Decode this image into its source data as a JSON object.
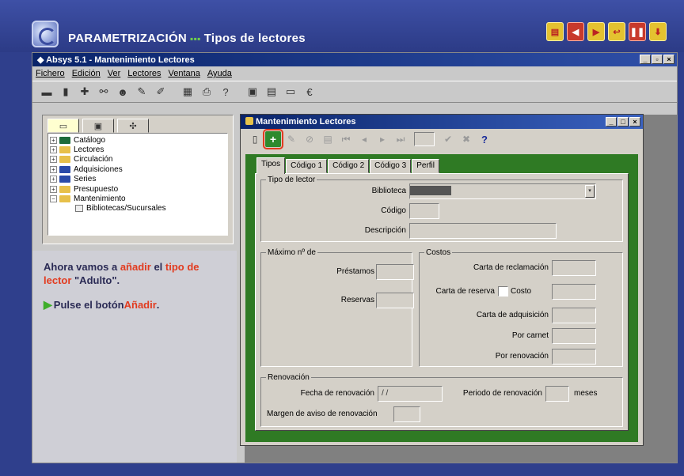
{
  "banner": {
    "title": "PARAMETRIZACIÓN",
    "separator": "▪▪▪",
    "subtitle": "Tipos de lectores"
  },
  "app": {
    "title": "◆ Absys 5.1 - Mantenimiento Lectores",
    "menu": [
      "Fichero",
      "Edición",
      "Ver",
      "Lectores",
      "Ventana",
      "Ayuda"
    ]
  },
  "tree": {
    "items": [
      "Catálogo",
      "Lectores",
      "Circulación",
      "Adquisiciones",
      "Series",
      "Presupuesto",
      "Mantenimiento"
    ],
    "subitem": "Bibliotecas/Sucursales"
  },
  "instructions": {
    "line1_pre": "Ahora vamos a ",
    "line1_hl1": "añadir",
    "line1_mid": " el ",
    "line1_hl2": "tipo de lector",
    "line1_post": " \"Adulto\".",
    "step_pre": "Pulse el botón ",
    "step_hl": "Añadir",
    "step_post": "."
  },
  "child": {
    "title": "Mantenimiento Lectores",
    "help": "?",
    "tabs": [
      "Tipos",
      "Código 1",
      "Código 2",
      "Código 3",
      "Perfil"
    ]
  },
  "form": {
    "tipo_legend": "Tipo de lector",
    "biblioteca": "Biblioteca",
    "codigo": "Código",
    "descripcion": "Descripción",
    "maximo_legend": "Máximo nº de",
    "prestamos": "Préstamos",
    "reservas": "Reservas",
    "costos_legend": "Costos",
    "carta_reclamacion": "Carta de reclamación",
    "carta_reserva": "Carta de reserva",
    "costo": "Costo",
    "carta_adquisicion": "Carta de adquisición",
    "por_carnet": "Por carnet",
    "por_renovacion": "Por renovación",
    "renovacion_legend": "Renovación",
    "fecha_renovacion": "Fecha de renovación",
    "fecha_value": "/ /",
    "periodo_renovacion": "Periodo de renovación",
    "meses": "meses",
    "margen_aviso": "Margen de aviso de renovación"
  }
}
